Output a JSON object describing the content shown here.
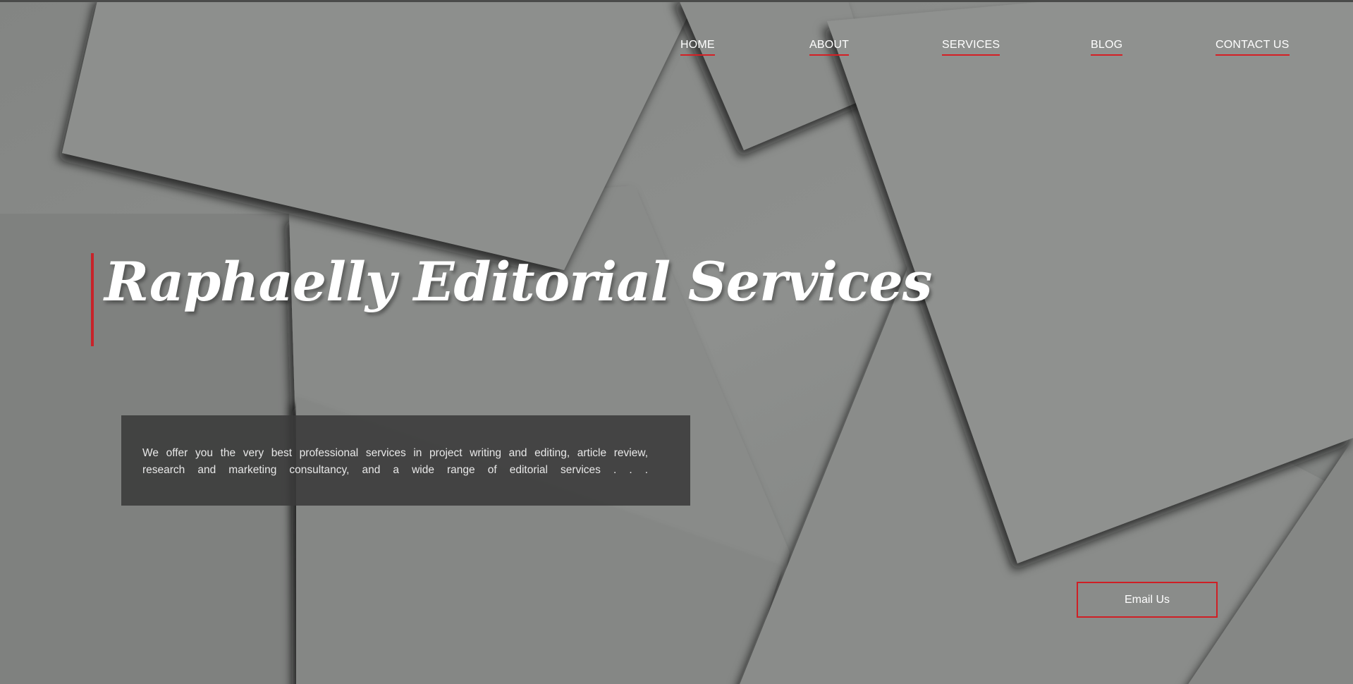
{
  "nav": {
    "items": [
      {
        "label": "HOME"
      },
      {
        "label": "ABOUT"
      },
      {
        "label": "SERVICES"
      },
      {
        "label": "BLOG"
      },
      {
        "label": "CONTACT US"
      }
    ]
  },
  "hero": {
    "title": "Raphaelly Editorial Services",
    "description": "We offer you the very best professional services in project writing and editing, article review, research and marketing consultancy, and a wide range of editorial services . . .",
    "cta_label": "Email Us"
  },
  "colors": {
    "accent": "#d51f24",
    "background": "#8a8c8a",
    "panel": "#3a3a3a",
    "text": "#ffffff"
  }
}
